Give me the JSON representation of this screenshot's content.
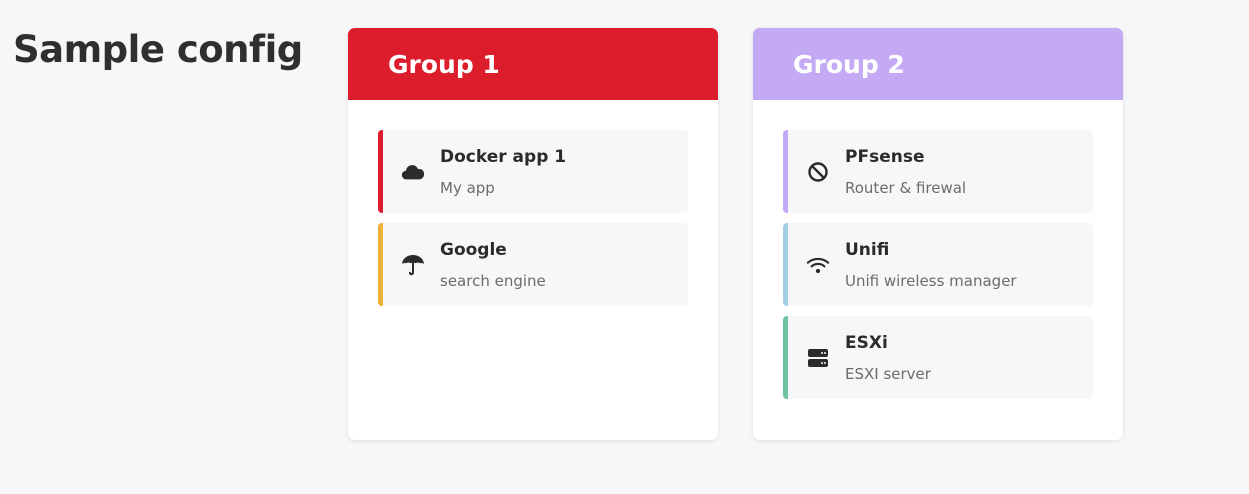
{
  "page": {
    "title": "Sample config"
  },
  "groups": [
    {
      "title": "Group 1",
      "color": "#dd1c2c",
      "items": [
        {
          "name": "Docker app 1",
          "subtitle": "My app",
          "icon": "cloud-icon",
          "color": "#dd1c2c"
        },
        {
          "name": "Google",
          "subtitle": "search engine",
          "icon": "umbrella-icon",
          "color": "#f2b23a"
        }
      ]
    },
    {
      "title": "Group 2",
      "color": "#c4a9f4",
      "items": [
        {
          "name": "PFsense",
          "subtitle": "Router & firewal",
          "icon": "ban-icon",
          "color": "#c4a9f4"
        },
        {
          "name": "Unifi",
          "subtitle": "Unifi wireless manager",
          "icon": "wifi-icon",
          "color": "#a4cdea"
        },
        {
          "name": "ESXi",
          "subtitle": "ESXI server",
          "icon": "server-icon",
          "color": "#6fc3a0"
        }
      ]
    }
  ]
}
